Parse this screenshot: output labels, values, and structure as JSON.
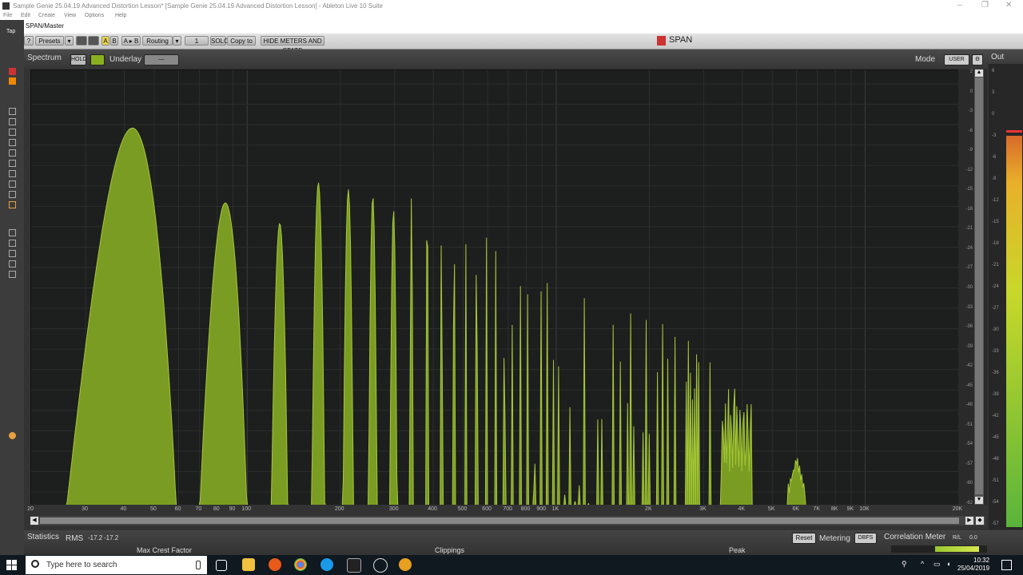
{
  "window": {
    "title": "Sample Genie 25.04.19 Advanced Distortion Lesson*  [Sample Genie 25.04.19 Advanced Distortion Lesson] - Ableton Live 10 Suite",
    "controls": [
      "–",
      "❐",
      "✕"
    ]
  },
  "menu": [
    "File",
    "Edit",
    "Create",
    "View",
    "Options",
    "Help"
  ],
  "left_strip": {
    "tab": "Tap"
  },
  "plugin": {
    "title": "SPAN/Master",
    "brand": "SPAN",
    "toolbar": {
      "help": "?",
      "presets": "Presets",
      "a": "A",
      "b": "B",
      "ab": "A ▸ B",
      "routing": "Routing",
      "channel": "1",
      "solo": "SOLO",
      "copy_to": "Copy to",
      "hide_meters": "HIDE METERS AND STATS"
    },
    "spectrum_header": {
      "label": "Spectrum",
      "hold": "HOLD",
      "underlay": "Underlay",
      "underlay_value": "—",
      "mode_label": "Mode",
      "mode_value": "USER",
      "out_label": "Out"
    },
    "db_scale": [
      "2",
      "0",
      "-3",
      "-6",
      "-9",
      "-12",
      "-15",
      "-18",
      "-21",
      "-24",
      "-27",
      "-30",
      "-33",
      "-36",
      "-39",
      "-42",
      "-45",
      "-48",
      "-51",
      "-54",
      "-57",
      "-60",
      "-62"
    ],
    "freq_ticks": [
      "20",
      "30",
      "40",
      "50",
      "60",
      "70",
      "80",
      "90",
      "100",
      "200",
      "300",
      "400",
      "500",
      "600",
      "700",
      "800",
      "900",
      "1K",
      "2K",
      "3K",
      "4K",
      "5K",
      "6K",
      "7K",
      "8K",
      "9K",
      "10K",
      "20K"
    ],
    "out_scale": [
      "6",
      "3",
      "0",
      "-3",
      "-6",
      "-9",
      "-12",
      "-15",
      "-18",
      "-21",
      "-24",
      "-27",
      "-30",
      "-33",
      "-36",
      "-39",
      "-42",
      "-45",
      "-48",
      "-51",
      "-54",
      "-57"
    ],
    "bottom": {
      "statistics": "Statistics",
      "rms": "RMS",
      "rms_l": "-17.2",
      "rms_r": "-17.2",
      "max_crest": "Max Crest Factor",
      "clippings": "Clippings",
      "peak": "Peak",
      "reset": "Reset",
      "metering": "Metering",
      "dbfs": "DBFS",
      "correlation": "Correlation Meter",
      "rl": "R/L",
      "rl_value": "0.0"
    },
    "spectrum_color": "#8ab020"
  },
  "taskbar": {
    "search_placeholder": "Type here to search",
    "time": "10:32",
    "date": "25/04/2019"
  }
}
